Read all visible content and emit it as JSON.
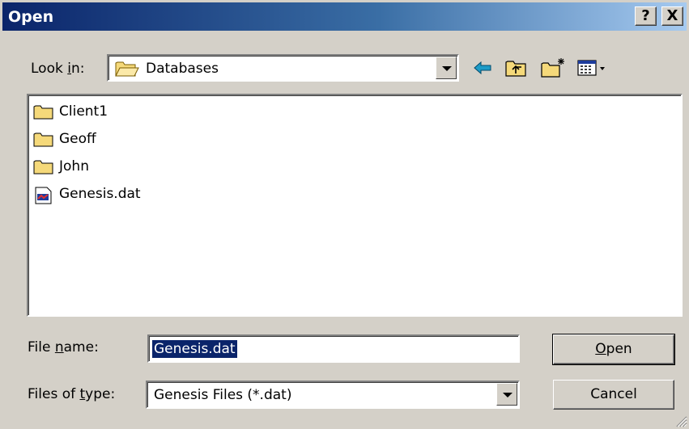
{
  "window": {
    "title": "Open",
    "help_label": "?",
    "close_label": "X"
  },
  "look_in": {
    "label_prefix": "Look ",
    "label_accel": "i",
    "label_suffix": "n:",
    "value": "Databases"
  },
  "toolbar": {
    "icons": [
      "back-icon",
      "up-folder-icon",
      "new-folder-icon",
      "view-menu-icon"
    ]
  },
  "files": [
    {
      "name": "Client1",
      "icon": "folder-icon"
    },
    {
      "name": "Geoff",
      "icon": "folder-icon"
    },
    {
      "name": "John",
      "icon": "folder-icon"
    },
    {
      "name": "Genesis.dat",
      "icon": "data-file-icon"
    }
  ],
  "file_name": {
    "label_prefix": "File ",
    "label_accel": "n",
    "label_suffix": "ame:",
    "value": "Genesis.dat"
  },
  "file_type": {
    "label_prefix": "Files of ",
    "label_accel": "t",
    "label_suffix": "ype:",
    "value": "Genesis Files (*.dat)"
  },
  "buttons": {
    "open_accel": "O",
    "open_rest": "pen",
    "cancel": "Cancel"
  },
  "colors": {
    "title_bar": "#0a246a",
    "selection": "#0a246a",
    "face": "#d4d0c8"
  }
}
